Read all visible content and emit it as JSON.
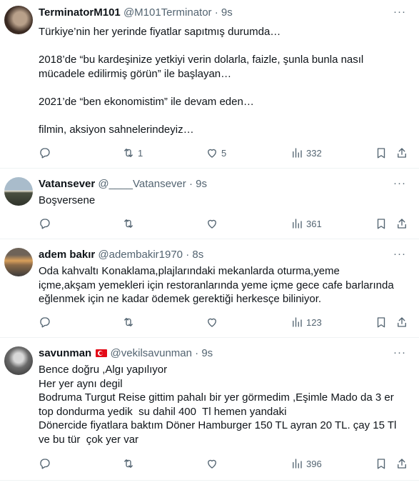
{
  "tweets": [
    {
      "name": "TerminatorM101",
      "handle": "@M101Terminator",
      "dot": "·",
      "time": "9s",
      "lines": [
        "Türkiye’nin her yerinde fiyatlar sapıtmış durumda…",
        "",
        "2018’de “bu kardeşinize yetkiyi verin dolarla, faizle, şunla bunla nasıl",
        "mücadele edilirmiş görün” ile başlayan…",
        "",
        "2021’de “ben ekonomistim” ile devam eden…",
        "",
        "filmin, aksiyon sahnelerindeyiz…"
      ],
      "reply_count": "",
      "retweet_count": "1",
      "like_count": "5",
      "view_count": "332",
      "avatar_colors": [
        "#3a2a22",
        "#b8a08a"
      ]
    },
    {
      "name": "Vatansever",
      "handle": "@____Vatansever",
      "dot": "·",
      "time": "9s",
      "lines": [
        "Boşversene"
      ],
      "reply_count": "",
      "retweet_count": "",
      "like_count": "",
      "view_count": "361",
      "avatar_colors": [
        "#8fa6b8",
        "#4a4f40"
      ]
    },
    {
      "name": "adem bakır",
      "handle": "@adembakir1970",
      "dot": "·",
      "time": "8s",
      "lines": [
        "Oda kahvaltı Konaklama,plajlarındaki mekanlarda oturma,yeme",
        "içme,akşam yemekleri için restoranlarında yeme içme gece cafe barlarında",
        "eğlenmek için ne kadar ödemek gerektiği herkesçe biliniyor."
      ],
      "reply_count": "",
      "retweet_count": "",
      "like_count": "",
      "view_count": "123",
      "avatar_colors": [
        "#d9a05a",
        "#3d3a3a"
      ]
    },
    {
      "name": "savunman",
      "handle": "@vekilsavunman",
      "dot": "·",
      "time": "9s",
      "lines": [
        "Bence doğru ,Algı yapılıyor",
        "Her yer aynı degil",
        "Bodruma Turgut Reise gittim pahalı bir yer görmedim ,Eşimle Mado da 3 er",
        "top dondurma yedik  su dahil 400  Tl hemen yandaki",
        "Dönercide fiyatlara baktım Döner Hamburger 150 TL ayran 20 TL. çay 15 Tl",
        "ve bu tür  çok yer var"
      ],
      "reply_count": "",
      "retweet_count": "",
      "like_count": "",
      "view_count": "396",
      "avatar_colors": [
        "#6b6b6b",
        "#d8d8d8"
      ]
    }
  ],
  "more_label": "···",
  "colors": {
    "text": "#0f1419",
    "secondary": "#536471",
    "divider": "#eff3f4",
    "flag_red": "#e30a17"
  }
}
